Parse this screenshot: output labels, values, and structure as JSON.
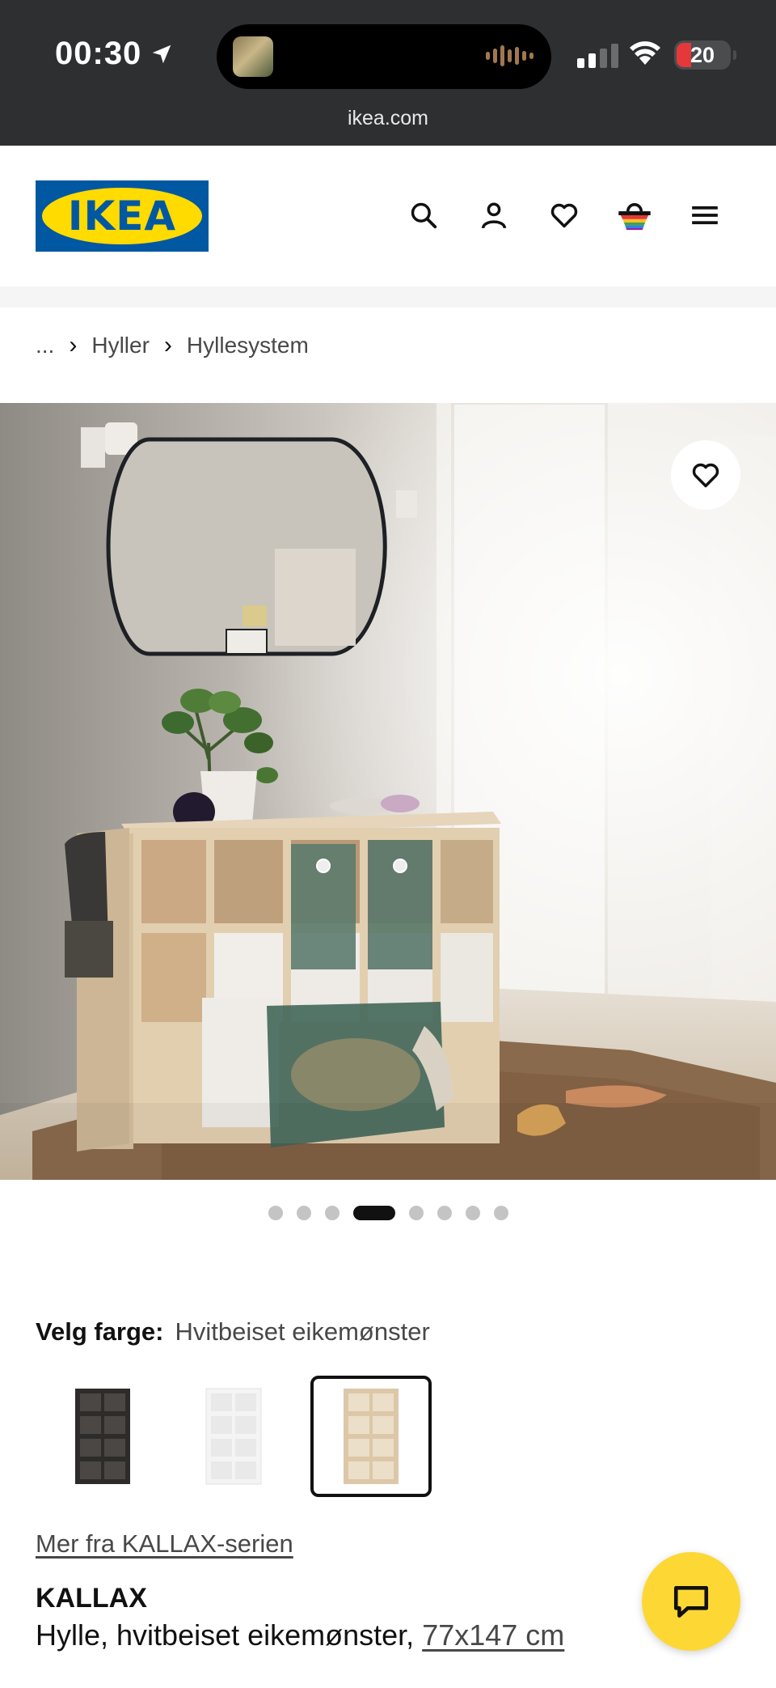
{
  "status_bar": {
    "time": "00:30",
    "battery": "20",
    "url": "ikea.com"
  },
  "header": {
    "logo_text": "IKEA",
    "icons": [
      "search-icon",
      "profile-icon",
      "heart-icon",
      "basket-icon",
      "menu-icon"
    ]
  },
  "breadcrumb": {
    "ellipsis": "...",
    "items": [
      "Hyller",
      "Hyllesystem"
    ]
  },
  "carousel": {
    "total": 8,
    "active_index": 3
  },
  "color_picker": {
    "label": "Velg farge:",
    "selected": "Hvitbeiset eikemønster",
    "options": [
      "black-brown",
      "white",
      "white-stained-oak"
    ],
    "colors": {
      "black_brown": "#2e2c2a",
      "white": "#f4f4f4",
      "oak": "#dcc7a8"
    }
  },
  "series_link": "Mer fra KALLAX-serien",
  "product": {
    "name": "KALLAX",
    "description": "Hylle, hvitbeiset eikemønster, ",
    "size": "77x147 cm"
  },
  "colors": {
    "brand_blue": "#0058a3",
    "brand_yellow": "#ffdb00",
    "chat_yellow": "#fdd835"
  }
}
